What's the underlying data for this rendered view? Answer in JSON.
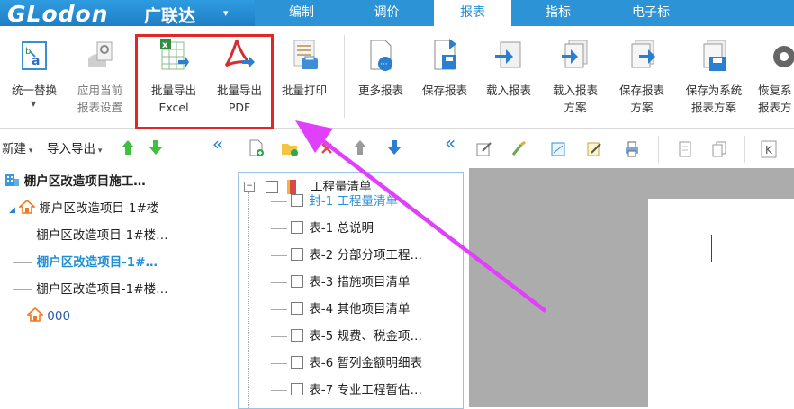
{
  "brand": {
    "logo_text": "GLodon",
    "logo_cn": "广联达",
    "menu_caret": "▾"
  },
  "menu_tabs": [
    {
      "label": "编制",
      "active": false
    },
    {
      "label": "调价",
      "active": false
    },
    {
      "label": "报表",
      "active": true
    },
    {
      "label": "指标",
      "active": false
    },
    {
      "label": "电子标",
      "active": false
    }
  ],
  "ribbon": {
    "unify_replace": "统一替换",
    "apply_current": "应用当前\n报表设置",
    "batch_excel": "批量导出\nExcel",
    "batch_pdf": "批量导出\nPDF",
    "batch_print": "批量打印",
    "more_reports": "更多报表",
    "save_report": "保存报表",
    "load_report": "载入报表",
    "load_scheme": "载入报表\n方案",
    "save_scheme": "保存报表\n方案",
    "save_system": "保存为系统\n报表方案",
    "restore": "恢复系\n报表方"
  },
  "left_panel": {
    "new_label": "新建",
    "import_export_label": "导入导出",
    "collapse": "«",
    "tree": [
      {
        "label": "棚户区改造项目施工…",
        "bold": true
      },
      {
        "label": "棚户区改造项目-1#楼"
      },
      {
        "label": "棚户区改造项目-1#楼…"
      },
      {
        "label": "棚户区改造项目-1#…",
        "bold": true,
        "selected": true
      },
      {
        "label": "棚户区改造项目-1#楼…"
      },
      {
        "label": "000"
      }
    ]
  },
  "middle_panel": {
    "collapse": "«",
    "root": "工程量清单",
    "items": [
      {
        "label": "封-1 工程量清单",
        "highlight": true
      },
      {
        "label": "表-1 总说明"
      },
      {
        "label": "表-2 分部分项工程…"
      },
      {
        "label": "表-3 措施项目清单"
      },
      {
        "label": "表-4 其他项目清单"
      },
      {
        "label": "表-5 规费、税金项…"
      },
      {
        "label": "表-6 暂列金额明细表"
      },
      {
        "label": "表-7 专业工程暂估…"
      }
    ]
  },
  "colors": {
    "brand_blue": "#2b93d6",
    "highlight_red": "#e52626",
    "arrow_magenta": "#e040fb",
    "selected_blue": "#1f8fd6"
  }
}
